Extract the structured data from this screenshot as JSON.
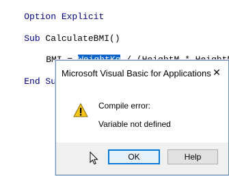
{
  "editor": {
    "line1": {
      "keyword": "Option",
      "rest": " Explicit"
    },
    "line2": {
      "keyword": "Sub",
      "rest": " CalculateBMI()"
    },
    "line3": {
      "lead": "BMI = ",
      "selected": "WeightKg",
      "rest": " / (HeightM * HeightM)"
    },
    "line4": {
      "keyword": "End Sub"
    }
  },
  "dialog": {
    "title": "Microsoft Visual Basic for Applications",
    "close_glyph": "✕",
    "icon": "warning-icon",
    "message_heading": "Compile error:",
    "message_detail": "Variable not defined",
    "buttons": {
      "ok_label": "OK",
      "help_label": "Help"
    }
  },
  "colors": {
    "keyword": "#00007f",
    "selection": "#0a64c8",
    "default_button_border": "#0078d7"
  }
}
